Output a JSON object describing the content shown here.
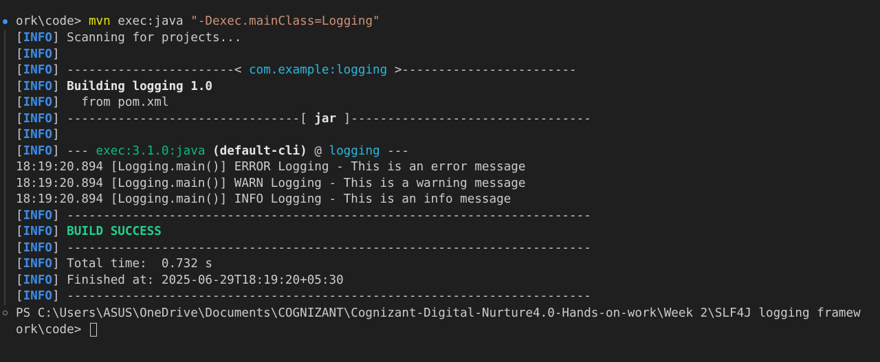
{
  "prompt": {
    "path": "ork\\code> ",
    "command": "mvn",
    "args": " exec:java ",
    "arg_string": "\"-Dexec.mainClass=Logging\""
  },
  "info_tag": "INFO",
  "lines": {
    "scanning": " Scanning for projects...",
    "dashes_left_1": " -----------------------< ",
    "artifact": "com.example:logging",
    "dashes_right_1": " >------------------------",
    "building": " Building logging 1.0",
    "from_pom": "   from pom.xml",
    "dashes_left_2": " --------------------------------[ ",
    "packaging": "jar",
    "dashes_right_2": " ]---------------------------------",
    "exec_prefix": " --- ",
    "plugin": "exec:3.1.0:java",
    "execution": " (default-cli) ",
    "at": "@ ",
    "project": "logging",
    "exec_suffix": " ---",
    "separator": " ------------------------------------------------------------------------",
    "build_success": " BUILD SUCCESS",
    "total_time": " Total time:  0.732 s",
    "finished_at": " Finished at: 2025-06-29T18:19:20+05:30"
  },
  "log_output": [
    "18:19:20.894 [Logging.main()] ERROR Logging - This is an error message",
    "18:19:20.894 [Logging.main()] WARN Logging - This is a warning message",
    "18:19:20.894 [Logging.main()] INFO Logging - This is an info message"
  ],
  "ps_prompt": {
    "line1": "PS C:\\Users\\ASUS\\OneDrive\\Documents\\COGNIZANT\\Cognizant-Digital-Nurture4.0-Hands-on-work\\Week 2\\SLF4J logging framew",
    "line2": "ork\\code> "
  },
  "colors": {
    "background": "#1f1f1f",
    "info": "#3b8eea",
    "command": "#e5e510",
    "string": "#ce9178",
    "cyan": "#29b8db",
    "success": "#23d18b",
    "decoration_success": "#3794ff"
  }
}
